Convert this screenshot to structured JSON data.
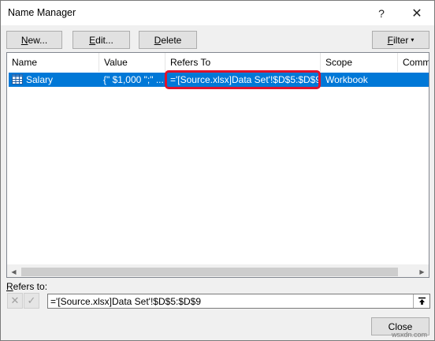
{
  "window": {
    "title": "Name Manager",
    "help_glyph": "?",
    "close_glyph": "✕"
  },
  "toolbar": {
    "new_prefix": "N",
    "new_rest": "ew...",
    "edit_prefix": "E",
    "edit_rest": "dit...",
    "delete_prefix": "D",
    "delete_rest": "elete",
    "filter_prefix": "F",
    "filter_rest": "ilter",
    "filter_arrow": "▾"
  },
  "list": {
    "columns": {
      "name": "Name",
      "value": "Value",
      "refers_to": "Refers To",
      "scope": "Scope",
      "comment": "Comm"
    },
    "rows": [
      {
        "name": "Salary",
        "value": "{\" $1,000 \";\" ...",
        "refers_to": "='[Source.xlsx]Data Set'!$D$5:$D$9",
        "scope": "Workbook",
        "icon": "table-range-icon"
      }
    ]
  },
  "refers_to_field": {
    "label_prefix": "R",
    "label_rest": "efers to:",
    "value": "='[Source.xlsx]Data Set'!$D$5:$D$9"
  },
  "footer": {
    "close_label": "Close"
  },
  "watermark": "wsxdn.com",
  "colors": {
    "selection": "#0078d7",
    "highlight_border": "#e0122c"
  }
}
